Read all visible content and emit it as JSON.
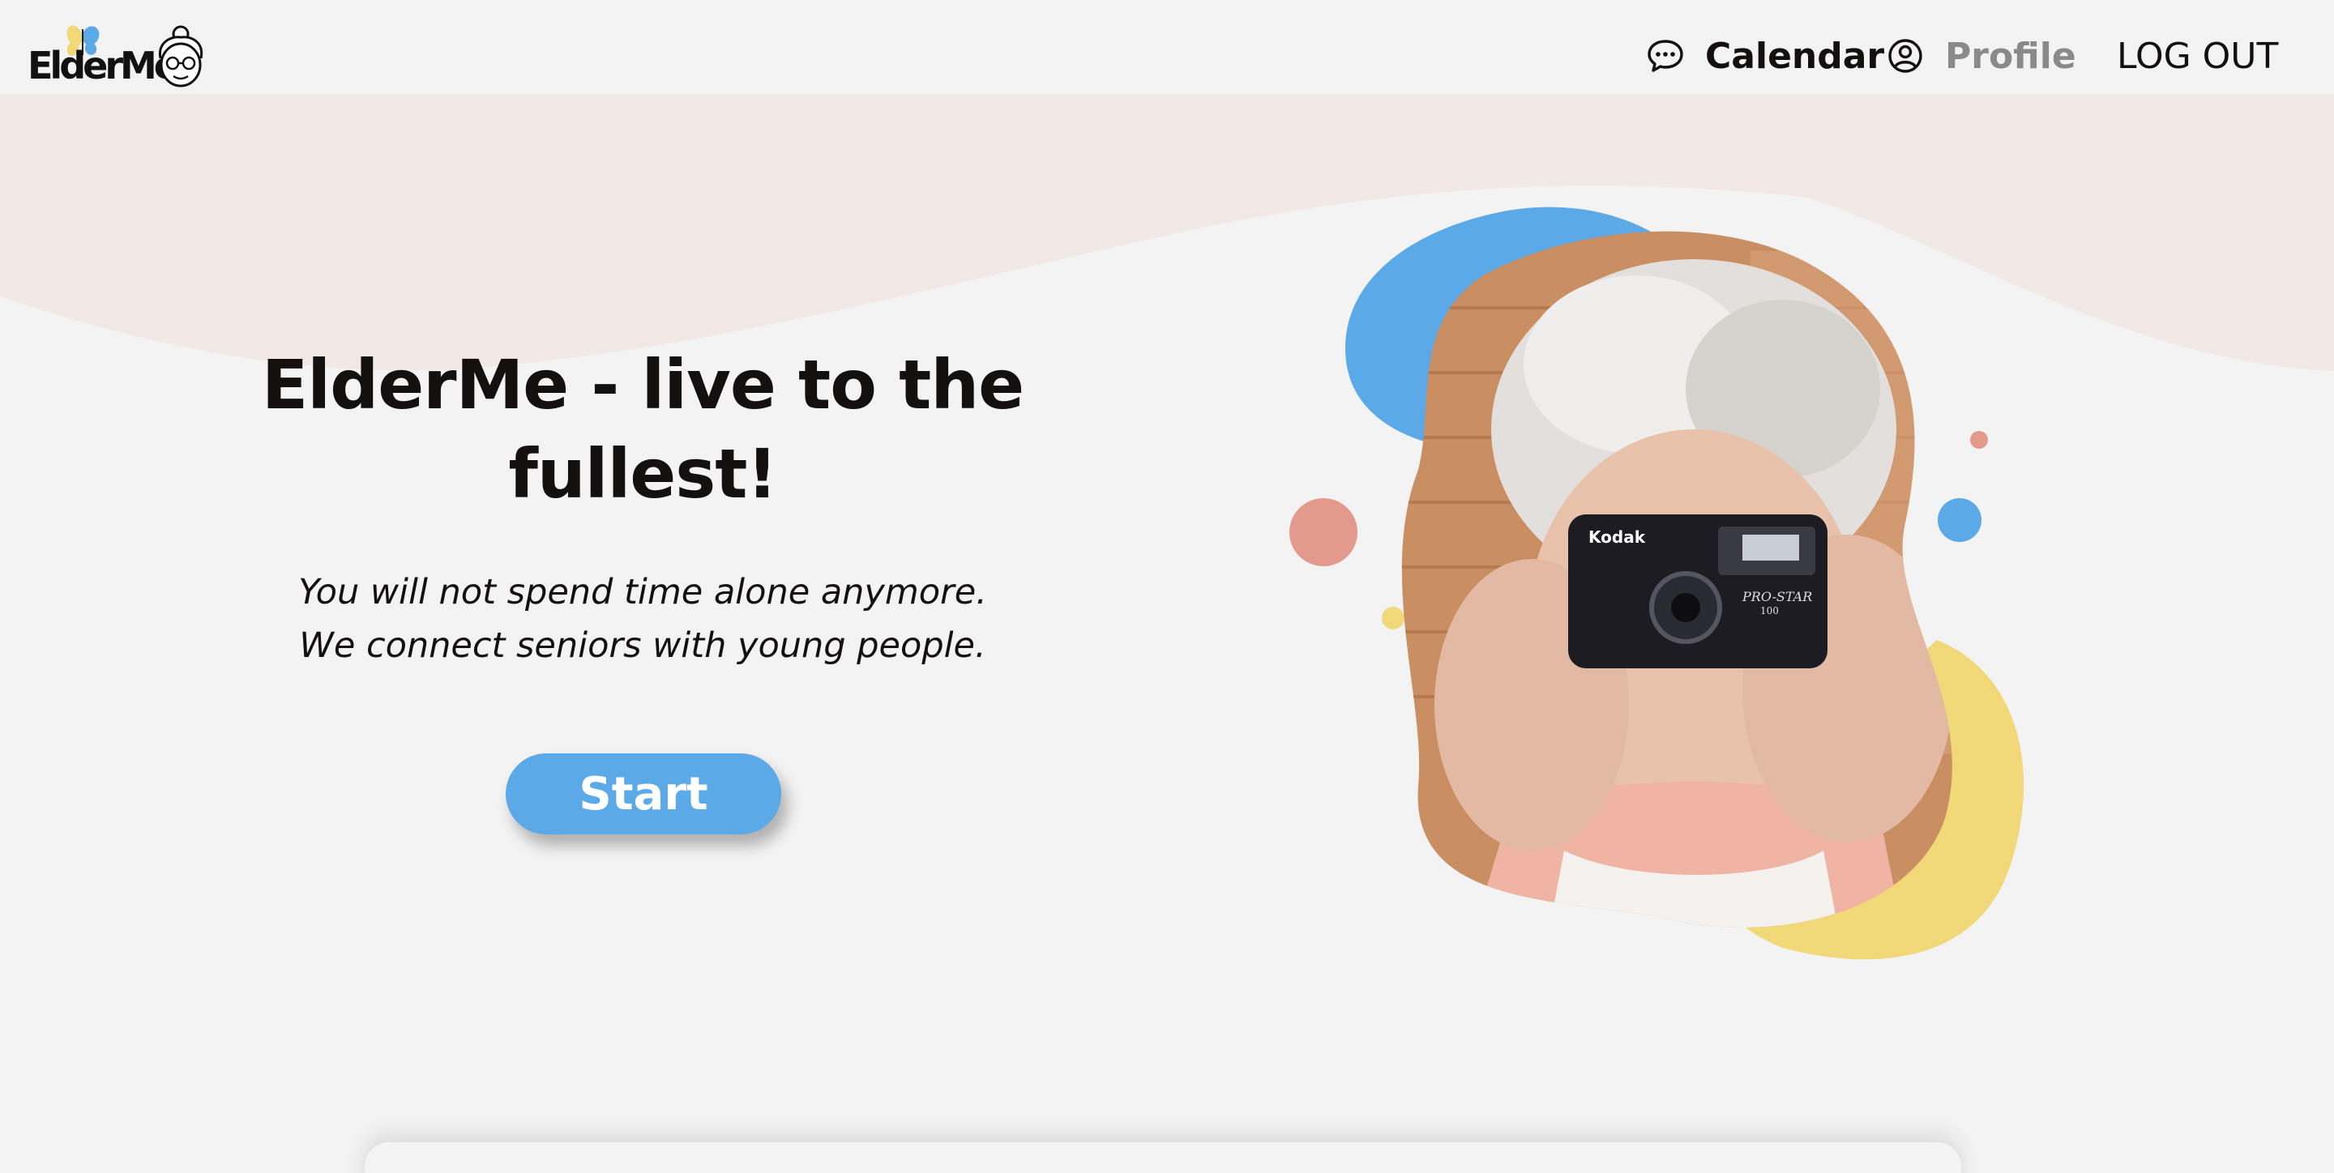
{
  "brand": {
    "logo_text": "ElderMe"
  },
  "nav": {
    "calendar_label": "Calendar",
    "profile_label": "Profile",
    "logout_label": "LOG OUT",
    "chat_icon": "chat-bubble-icon",
    "profile_icon": "user-circle-icon"
  },
  "hero": {
    "title": "ElderMe - live to the fullest!",
    "subtitle": "You will not spend time alone anymore. We connect seniors with young people.",
    "start_label": "Start"
  },
  "illustration": {
    "camera_brand": "Kodak",
    "camera_model": "PRO-STAR",
    "camera_model_number": "100"
  },
  "colors": {
    "background": "#f3f3f3",
    "wave_pink": "#f2e8e6",
    "accent_blue": "#5ca9e8",
    "accent_yellow": "#f1d97a",
    "accent_coral": "#e3998c",
    "profile_gray": "#8a8a8a",
    "text_dark": "#141010"
  }
}
